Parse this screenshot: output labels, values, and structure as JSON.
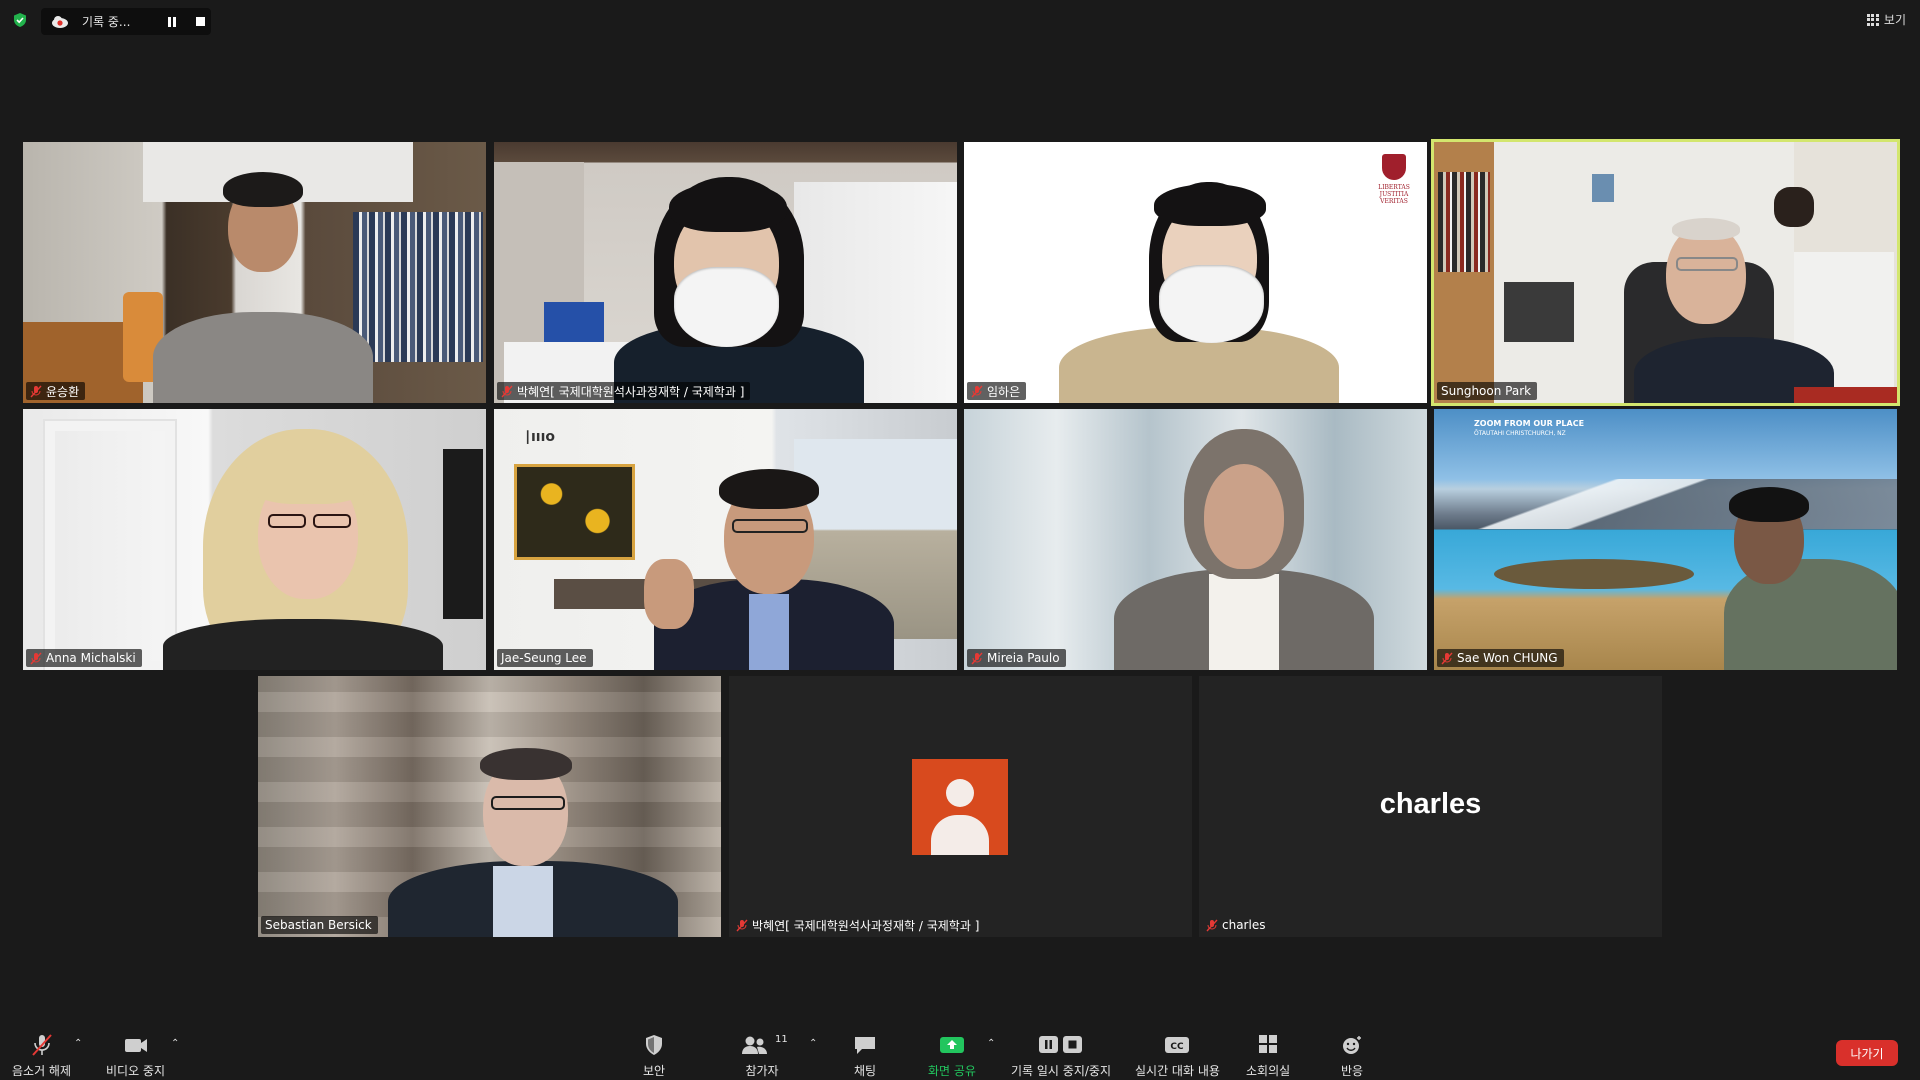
{
  "top_bar": {
    "recording_label": "기록 중...",
    "view_label": "보기"
  },
  "tiles": [
    {
      "name": "윤승환",
      "muted": true,
      "active": false
    },
    {
      "name": "박혜연[ 국제대학원석사과정재학 / 국제학과 ]",
      "muted": true,
      "active": false
    },
    {
      "name": "임하은",
      "muted": true,
      "active": false
    },
    {
      "name": "Sunghoon Park",
      "muted": false,
      "active": true
    },
    {
      "name": "Anna Michalski",
      "muted": true,
      "active": false
    },
    {
      "name": "Jae-Seung Lee",
      "muted": false,
      "active": false
    },
    {
      "name": "Mireia Paulo",
      "muted": true,
      "active": false
    },
    {
      "name": "Sae Won CHUNG",
      "muted": true,
      "active": false
    },
    {
      "name": "Sebastian Bersick",
      "muted": false,
      "active": false
    },
    {
      "name": "박혜연[ 국제대학원석사과정재학 / 국제학과 ]",
      "muted": true,
      "active": false,
      "avatar": "person-avatar-icon"
    },
    {
      "name": "charles",
      "muted": true,
      "active": false,
      "display_name": "charles"
    }
  ],
  "backgrounds": {
    "sae_won_overlay_line1": "ZOOM FROM OUR PLACE",
    "sae_won_overlay_line2": "ŌTAUTAHI CHRISTCHURCH, NZ",
    "im_haeun_crest_text": "LIBERTAS JUSTITIA VERITAS"
  },
  "toolbar": {
    "unmute": "음소거 해제",
    "stop_video": "비디오 중지",
    "security": "보안",
    "participants": "참가자",
    "participants_count": "11",
    "chat": "채팅",
    "share_screen": "화면 공유",
    "record_pause_stop": "기록 일시 중지/중지",
    "live_transcript": "실시간 대화 내용",
    "breakout_rooms": "소회의실",
    "reactions": "반응",
    "leave": "나가기"
  },
  "colors": {
    "background": "#1a1a1a",
    "active_speaker_border": "#d3e66e",
    "share_green": "#22c55e",
    "leave_red": "#d9302b",
    "avatar_orange": "#d84a1e"
  }
}
